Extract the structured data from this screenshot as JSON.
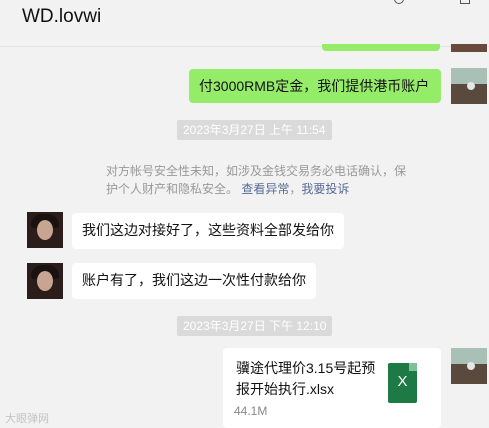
{
  "header": {
    "title": "WD.lovwi"
  },
  "messages": {
    "out1": "付3000RMB定金，我们提供港币账户",
    "ts1": "2023年3月27日 上午 11:54",
    "system_text": "对方帐号安全性未知，如涉及金钱交易务必电话确认，保护个人财产和隐私安全。",
    "system_link1": "查看异常",
    "system_link2": "我要投诉",
    "in1": "我们这边对接好了，这些资料全部发给你",
    "in2": "账户有了，我们这边一次性付款给你",
    "ts2": "2023年3月27日 下午 12:10",
    "file": {
      "name": "骥途代理价3.15号起预报开始执行.xlsx",
      "size": "44.1M",
      "icon_letter": "X"
    }
  },
  "watermark": "大眼弹网",
  "colors": {
    "sent_bubble": "#95ec69",
    "received_bubble": "#ffffff",
    "link": "#576b95",
    "xlsx": "#1e7a45"
  }
}
